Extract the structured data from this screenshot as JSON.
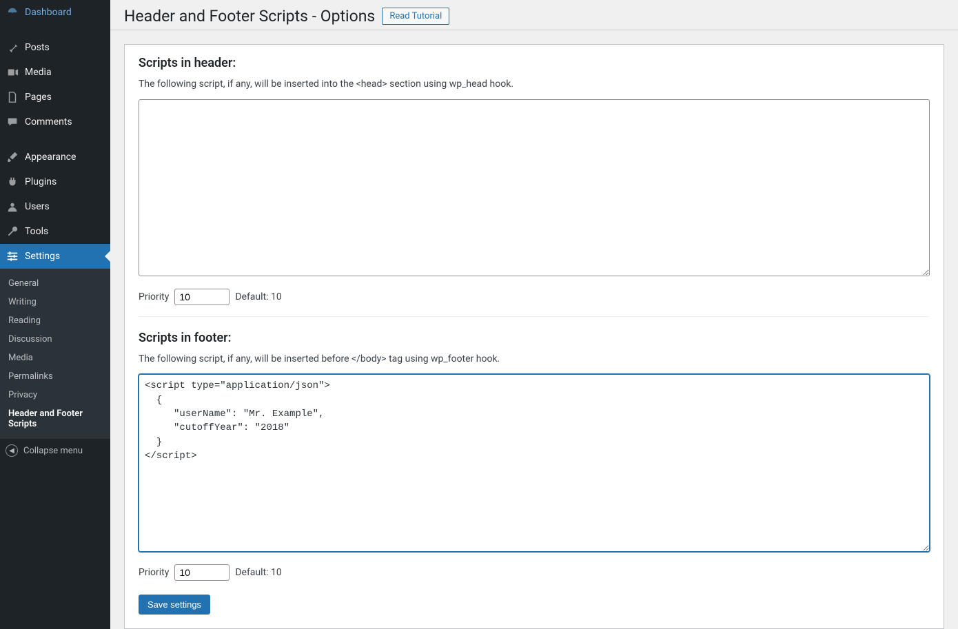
{
  "sidebar": {
    "items": [
      {
        "label": "Dashboard",
        "icon": "dashboard-icon"
      },
      {
        "label": "Posts",
        "icon": "pin-icon"
      },
      {
        "label": "Media",
        "icon": "media-icon"
      },
      {
        "label": "Pages",
        "icon": "page-icon"
      },
      {
        "label": "Comments",
        "icon": "comment-icon"
      },
      {
        "label": "Appearance",
        "icon": "brush-icon"
      },
      {
        "label": "Plugins",
        "icon": "plug-icon"
      },
      {
        "label": "Users",
        "icon": "user-icon"
      },
      {
        "label": "Tools",
        "icon": "wrench-icon"
      },
      {
        "label": "Settings",
        "icon": "sliders-icon"
      }
    ],
    "submenu": [
      {
        "label": "General"
      },
      {
        "label": "Writing"
      },
      {
        "label": "Reading"
      },
      {
        "label": "Discussion"
      },
      {
        "label": "Media"
      },
      {
        "label": "Permalinks"
      },
      {
        "label": "Privacy"
      },
      {
        "label": "Header and Footer Scripts"
      }
    ],
    "collapse_label": "Collapse menu"
  },
  "header": {
    "title": "Header and Footer Scripts - Options",
    "tutorial_button": "Read Tutorial"
  },
  "sections": {
    "header_scripts": {
      "title": "Scripts in header:",
      "desc": "The following script, if any, will be inserted into the <head> section using wp_head hook.",
      "value": "",
      "priority_label": "Priority",
      "priority_value": "10",
      "default_label": "Default: 10"
    },
    "footer_scripts": {
      "title": "Scripts in footer:",
      "desc": "The following script, if any, will be inserted before </body> tag using wp_footer hook.",
      "value": "<script type=\"application/json\">\n  {\n     \"userName\": \"Mr. Example\",\n     \"cutoffYear\": \"2018\"\n  }\n</script>",
      "priority_label": "Priority",
      "priority_value": "10",
      "default_label": "Default: 10"
    }
  },
  "save_button": "Save settings"
}
